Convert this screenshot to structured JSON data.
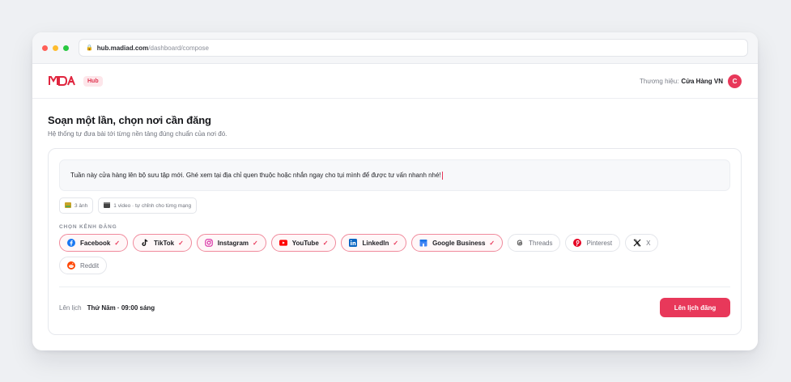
{
  "browser": {
    "url_host": "hub.madiad.com",
    "url_path": "/dashboard/compose",
    "dot_colors": [
      "#ff5f57",
      "#febc2e",
      "#28c840"
    ]
  },
  "header": {
    "logo_text": "MDA",
    "hub_badge": "Hub",
    "brand_label": "Thương hiệu:",
    "brand_value": "Cửa Hàng VN",
    "avatar_initial": "C"
  },
  "page": {
    "title": "Soạn một lần, chọn nơi cần đăng",
    "subtitle": "Hệ thống tự đưa bài tới từng nền tảng đúng chuẩn của nơi đó."
  },
  "composer": {
    "text": "Tuần này cửa hàng lên bộ sưu tập mới. Ghé xem tại địa chỉ quen thuộc hoặc nhắn ngay cho tụi mình để được tư vấn nhanh nhé!"
  },
  "media": [
    {
      "icon": "image-icon",
      "label": "3 ảnh"
    },
    {
      "icon": "video-icon",
      "label": "1 video · tự chỉnh cho từng mạng"
    }
  ],
  "channels_label": "CHỌN KÊNH ĐĂNG",
  "channels": [
    {
      "name": "Facebook",
      "selected": true,
      "icon": "facebook-icon",
      "color": "#1877f2"
    },
    {
      "name": "TikTok",
      "selected": true,
      "icon": "tiktok-icon",
      "color": "#111111"
    },
    {
      "name": "Instagram",
      "selected": true,
      "icon": "instagram-icon",
      "color": "#d6249f"
    },
    {
      "name": "YouTube",
      "selected": true,
      "icon": "youtube-icon",
      "color": "#ff0000"
    },
    {
      "name": "LinkedIn",
      "selected": true,
      "icon": "linkedin-icon",
      "color": "#0a66c2"
    },
    {
      "name": "Google Business",
      "selected": true,
      "icon": "google-business-icon",
      "color": "#4285f4"
    },
    {
      "name": "Threads",
      "selected": false,
      "icon": "threads-icon",
      "color": "#333333"
    },
    {
      "name": "Pinterest",
      "selected": false,
      "icon": "pinterest-icon",
      "color": "#e60023"
    },
    {
      "name": "X",
      "selected": false,
      "icon": "x-icon",
      "color": "#111111"
    },
    {
      "name": "Reddit",
      "selected": false,
      "icon": "reddit-icon",
      "color": "#ff4500"
    }
  ],
  "schedule": {
    "label": "Lên lịch",
    "value": "Thứ Năm · 09:00 sáng",
    "button": "Lên lịch đăng"
  },
  "colors": {
    "accent": "#e8385a"
  }
}
